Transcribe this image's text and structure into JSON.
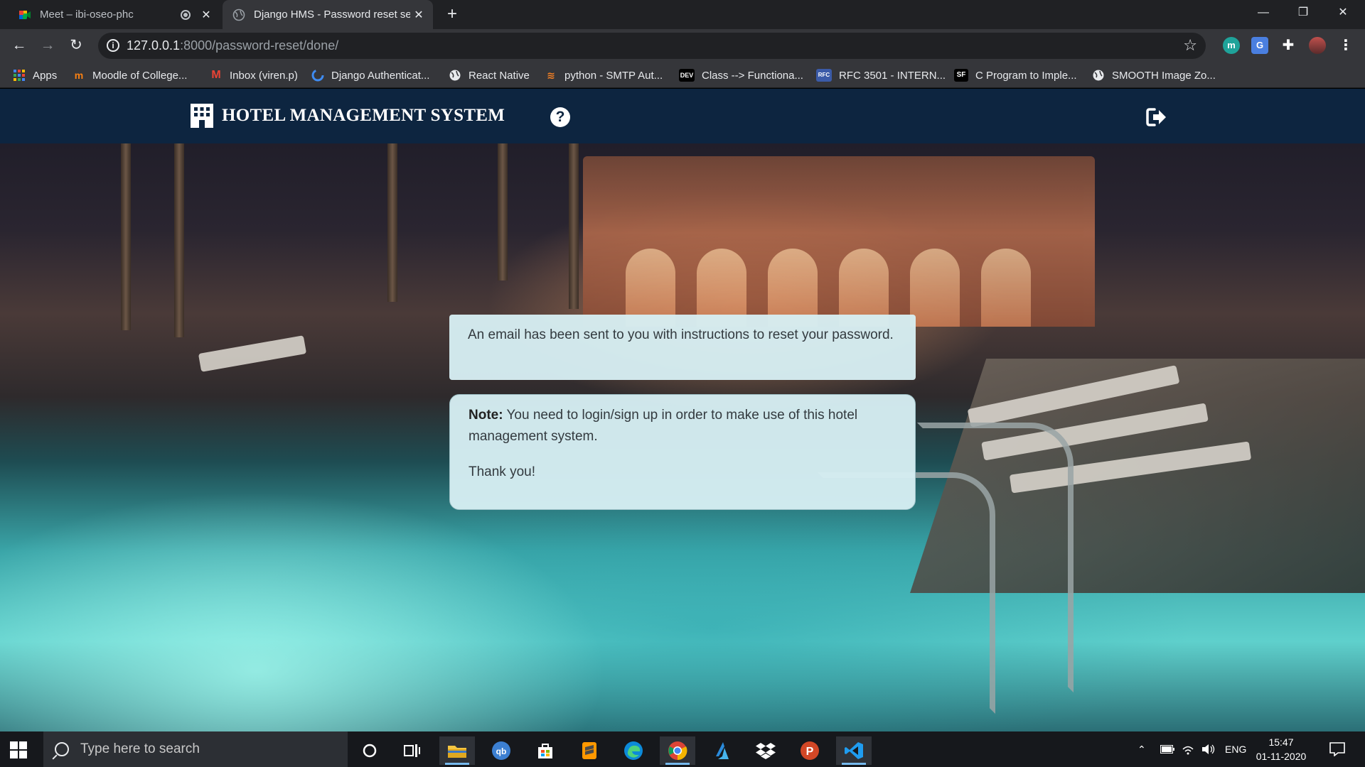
{
  "browser": {
    "tabs": [
      {
        "title": "Meet – ibi-oseo-phc",
        "active": false
      },
      {
        "title": "Django HMS - Password reset se",
        "active": true
      }
    ],
    "new_tab_label": "+",
    "window_controls": {
      "minimize": "—",
      "restore": "❐",
      "close": "✕"
    },
    "address": {
      "host": "127.0.0.1",
      "path": ":8000/password-reset/done/"
    },
    "bookmarks": [
      {
        "label": "Apps",
        "icon": "apps-grid-icon"
      },
      {
        "label": "Moodle of College...",
        "icon": "moodle-icon"
      },
      {
        "label": "Inbox (viren.p)",
        "icon": "gmail-icon"
      },
      {
        "label": "Django Authenticat...",
        "icon": "loader-icon"
      },
      {
        "label": "React Native",
        "icon": "globe-icon"
      },
      {
        "label": "python - SMTP Aut...",
        "icon": "stackoverflow-icon"
      },
      {
        "label": "Class --> Functiona...",
        "icon": "dev-icon",
        "badge": "DEV"
      },
      {
        "label": "RFC 3501 - INTERN...",
        "icon": "rfc-icon",
        "badge": "RFC"
      },
      {
        "label": "C Program to Imple...",
        "icon": "sf-icon",
        "badge": "SF"
      },
      {
        "label": "SMOOTH Image Zo...",
        "icon": "globe-icon"
      }
    ]
  },
  "navbar": {
    "brand": "HOTEL MANAGEMENT SYSTEM",
    "help_icon": "question-circle-icon",
    "logout_icon": "sign-out-icon",
    "background": "#0d2540"
  },
  "messages": {
    "reset_sent": "An email has been sent to you with instructions to reset your password.",
    "note_label": "Note:",
    "note_text": " You need to login/sign up in order to make use of this hotel management system.",
    "thanks": "Thank you!"
  },
  "taskbar": {
    "search_placeholder": "Type here to search",
    "language": "ENG",
    "time": "15:47",
    "date": "01-11-2020",
    "apps": [
      "cortana-icon",
      "task-view-icon",
      "file-explorer-icon",
      "qbittorrent-icon",
      "store-icon",
      "sublime-icon",
      "edge-icon",
      "chrome-icon",
      "azure-icon",
      "dropbox-icon",
      "powerpoint-icon",
      "vscode-icon"
    ]
  }
}
